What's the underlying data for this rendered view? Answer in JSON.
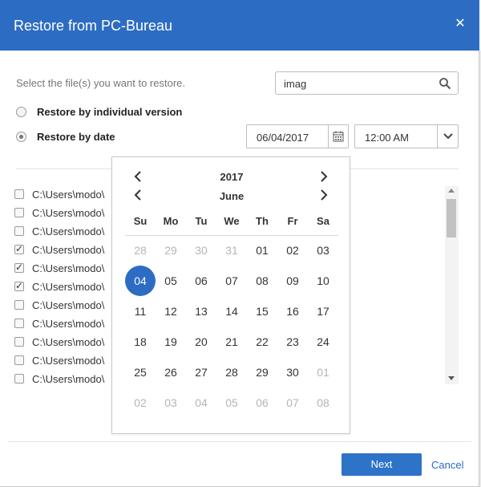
{
  "dialog": {
    "title": "Restore from PC-Bureau",
    "close_icon": "close-icon",
    "accent": "#2d6cc3"
  },
  "instruction": "Select the file(s) you want to restore.",
  "search": {
    "value": "imag",
    "icon": "search-icon"
  },
  "restore_options": {
    "individual_label": "Restore by individual version",
    "date_label": "Restore by date",
    "selected": "date"
  },
  "date_field": {
    "value": "06/04/2017",
    "icon": "calendar-icon"
  },
  "time_field": {
    "value": "12:00 AM",
    "icon": "chevron-down-icon"
  },
  "files": [
    {
      "path": "C:\\Users\\modo\\",
      "checked": false
    },
    {
      "path": "C:\\Users\\modo\\",
      "checked": false
    },
    {
      "path": "C:\\Users\\modo\\",
      "checked": false
    },
    {
      "path": "C:\\Users\\modo\\",
      "checked": true
    },
    {
      "path": "C:\\Users\\modo\\",
      "checked": true
    },
    {
      "path": "C:\\Users\\modo\\",
      "checked": true
    },
    {
      "path": "C:\\Users\\modo\\",
      "checked": false
    },
    {
      "path": "C:\\Users\\modo\\",
      "checked": false
    },
    {
      "path": "C:\\Users\\modo\\",
      "checked": false
    },
    {
      "path": "C:\\Users\\modo\\",
      "checked": false
    },
    {
      "path": "C:\\Users\\modo\\",
      "checked": false
    }
  ],
  "calendar": {
    "year": "2017",
    "month": "June",
    "weekdays": [
      "Su",
      "Mo",
      "Tu",
      "We",
      "Th",
      "Fr",
      "Sa"
    ],
    "weeks": [
      [
        {
          "d": "28",
          "other": true
        },
        {
          "d": "29",
          "other": true
        },
        {
          "d": "30",
          "other": true
        },
        {
          "d": "31",
          "other": true
        },
        {
          "d": "01"
        },
        {
          "d": "02"
        },
        {
          "d": "03"
        }
      ],
      [
        {
          "d": "04",
          "selected": true
        },
        {
          "d": "05"
        },
        {
          "d": "06"
        },
        {
          "d": "07"
        },
        {
          "d": "08"
        },
        {
          "d": "09"
        },
        {
          "d": "10"
        }
      ],
      [
        {
          "d": "11"
        },
        {
          "d": "12"
        },
        {
          "d": "13"
        },
        {
          "d": "14"
        },
        {
          "d": "15"
        },
        {
          "d": "16"
        },
        {
          "d": "17"
        }
      ],
      [
        {
          "d": "18"
        },
        {
          "d": "19"
        },
        {
          "d": "20"
        },
        {
          "d": "21"
        },
        {
          "d": "22"
        },
        {
          "d": "23"
        },
        {
          "d": "24"
        }
      ],
      [
        {
          "d": "25"
        },
        {
          "d": "26"
        },
        {
          "d": "27"
        },
        {
          "d": "28"
        },
        {
          "d": "29"
        },
        {
          "d": "30"
        },
        {
          "d": "01",
          "other": true
        }
      ],
      [
        {
          "d": "02",
          "other": true
        },
        {
          "d": "03",
          "other": true
        },
        {
          "d": "04",
          "other": true
        },
        {
          "d": "05",
          "other": true
        },
        {
          "d": "06",
          "other": true
        },
        {
          "d": "07",
          "other": true
        },
        {
          "d": "08",
          "other": true
        }
      ]
    ]
  },
  "footer": {
    "next_label": "Next",
    "cancel_label": "Cancel"
  }
}
